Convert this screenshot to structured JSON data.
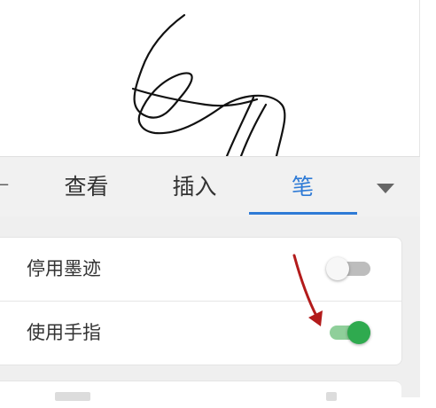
{
  "ribbon": {
    "tabs": [
      {
        "label": "查看",
        "active": false
      },
      {
        "label": "插入",
        "active": false
      },
      {
        "label": "笔",
        "active": true
      }
    ],
    "more_icon": "chevron-down-icon",
    "accent_color": "#2f7bd6"
  },
  "settings": {
    "rows": [
      {
        "label": "停用墨迹",
        "toggle_on": false
      },
      {
        "label": "使用手指",
        "toggle_on": true
      }
    ],
    "toggle_on_color": "#2faa4f",
    "toggle_off_color": "#bdbdbd"
  },
  "annotation": {
    "icon": "arrow-down-left-icon",
    "color": "#b31b1b"
  }
}
